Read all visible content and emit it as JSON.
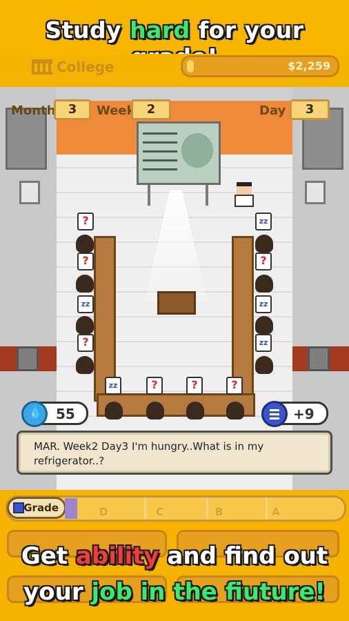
{
  "promo": {
    "top_prefix": "Study",
    "top_highlight": "hard",
    "top_suffix": "for your grade!",
    "bottom_line1_prefix": "Get",
    "bottom_line1_highlight": "ability",
    "bottom_line1_suffix": "and find out",
    "bottom_line2_prefix": "your",
    "bottom_line2_highlight": "job in the fiuture!"
  },
  "header": {
    "college_label": "College",
    "money": "$2,259"
  },
  "calendar": {
    "month_label": "Month",
    "month_value": "3",
    "week_label": "Week",
    "week_value": "2",
    "day_label": "Day",
    "day_value": "3"
  },
  "stats": {
    "water_value": "55",
    "study_value": "+9"
  },
  "dialog": {
    "message": "MAR. Week2 Day3 I'm hungry..What is in my refrigerator..?"
  },
  "grade": {
    "label": "Grade",
    "levels": [
      "D",
      "C",
      "B",
      "A"
    ],
    "progress_fraction": 0.05
  },
  "bubbles": {
    "question": "?",
    "sleep": "zz"
  },
  "colors": {
    "background": "#f5b300",
    "highlight_green": "#3ee86d",
    "highlight_red": "#f23b3b"
  }
}
